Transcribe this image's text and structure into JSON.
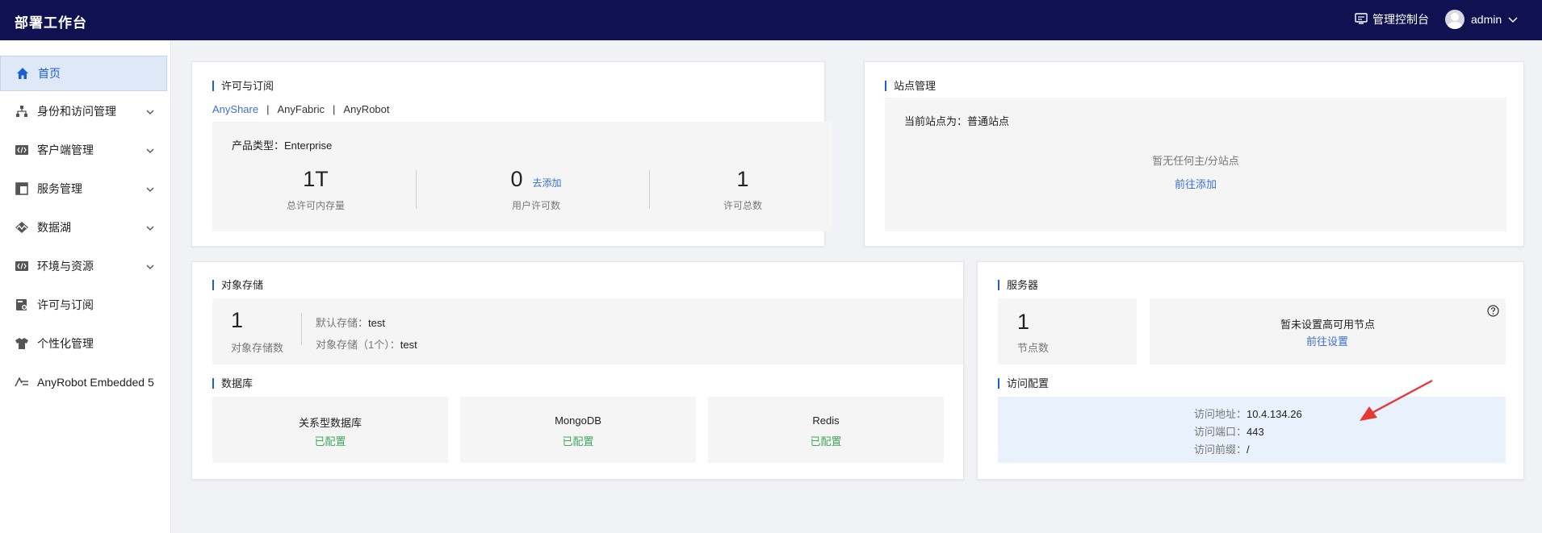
{
  "header": {
    "app_title": "部署工作台",
    "console_label": "管理控制台",
    "user_name": "admin"
  },
  "sidebar": {
    "items": [
      {
        "label": "首页",
        "icon": "home-icon",
        "active": true,
        "expandable": false
      },
      {
        "label": "身份和访问管理",
        "icon": "org-tree-icon",
        "active": false,
        "expandable": true
      },
      {
        "label": "客户端管理",
        "icon": "code-window-icon",
        "active": false,
        "expandable": true
      },
      {
        "label": "服务管理",
        "icon": "layout-icon",
        "active": false,
        "expandable": true
      },
      {
        "label": "数据湖",
        "icon": "wave-icon",
        "active": false,
        "expandable": true
      },
      {
        "label": "环境与资源",
        "icon": "code-window-icon",
        "active": false,
        "expandable": true
      },
      {
        "label": "许可与订阅",
        "icon": "license-icon",
        "active": false,
        "expandable": false
      },
      {
        "label": "个性化管理",
        "icon": "shirt-icon",
        "active": false,
        "expandable": false
      },
      {
        "label": "AnyRobot Embedded 5",
        "icon": "anyrobot-icon",
        "active": false,
        "expandable": false
      }
    ]
  },
  "license": {
    "title": "许可与订阅",
    "tabs": [
      "AnyShare",
      "AnyFabric",
      "AnyRobot"
    ],
    "tab_separator": "|",
    "product_type": "产品类型：Enterprise",
    "stats": [
      {
        "value": "1T",
        "label": "总许可内存量"
      },
      {
        "value": "0",
        "label": "用户许可数",
        "action": "去添加"
      },
      {
        "value": "1",
        "label": "许可总数"
      }
    ]
  },
  "site": {
    "title": "站点管理",
    "current": "当前站点为：普通站点",
    "empty": "暂无任何主/分站点",
    "action": "前往添加"
  },
  "object_storage": {
    "title": "对象存储",
    "count": "1",
    "count_label": "对象存储数",
    "default_label": "默认存储：",
    "default_value": "test",
    "list_label": "对象存储（1个）：",
    "list_value": "test"
  },
  "database": {
    "title": "数据库",
    "items": [
      {
        "name": "关系型数据库",
        "status": "已配置"
      },
      {
        "name": "MongoDB",
        "status": "已配置"
      },
      {
        "name": "Redis",
        "status": "已配置"
      }
    ]
  },
  "server": {
    "title": "服务器",
    "node_count": "1",
    "node_label": "节点数",
    "ha_text": "暂未设置高可用节点",
    "ha_action": "前往设置"
  },
  "access": {
    "title": "访问配置",
    "address_label": "访问地址：",
    "address_value": "10.4.134.26",
    "port_label": "访问端口：",
    "port_value": "443",
    "prefix_label": "访问前缀：",
    "prefix_value": "/"
  },
  "colors": {
    "topbar": "#0f1150",
    "accent": "#1a5fd6",
    "success": "#3fa85b",
    "arrow": "#e53935",
    "access_panel": "#e8f1fc"
  }
}
